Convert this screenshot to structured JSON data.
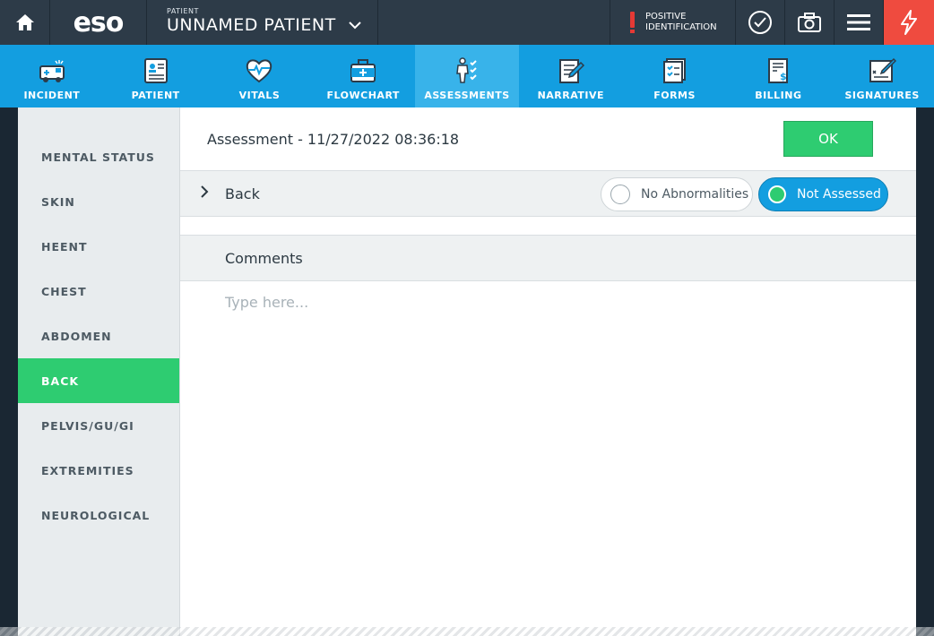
{
  "topbar": {
    "logo": "eso",
    "patient_label": "PATIENT",
    "patient_name": "UNNAMED PATIENT",
    "positive_id_line1": "POSITIVE",
    "positive_id_line2": "IDENTIFICATION"
  },
  "nav": {
    "items": [
      {
        "label": "INCIDENT",
        "icon": "ambulance-icon"
      },
      {
        "label": "PATIENT",
        "icon": "patient-card-icon"
      },
      {
        "label": "VITALS",
        "icon": "heart-pulse-icon"
      },
      {
        "label": "FLOWCHART",
        "icon": "medical-bag-icon"
      },
      {
        "label": "ASSESSMENTS",
        "icon": "body-check-icon"
      },
      {
        "label": "NARRATIVE",
        "icon": "notepad-icon"
      },
      {
        "label": "FORMS",
        "icon": "checklist-icon"
      },
      {
        "label": "BILLING",
        "icon": "bill-icon"
      },
      {
        "label": "SIGNATURES",
        "icon": "signature-icon"
      }
    ],
    "active": "ASSESSMENTS"
  },
  "sidebar": {
    "items": [
      {
        "label": "MENTAL STATUS"
      },
      {
        "label": "SKIN"
      },
      {
        "label": "HEENT"
      },
      {
        "label": "CHEST"
      },
      {
        "label": "ABDOMEN"
      },
      {
        "label": "BACK"
      },
      {
        "label": "PELVIS/GU/GI"
      },
      {
        "label": "EXTREMITIES"
      },
      {
        "label": "NEUROLOGICAL"
      }
    ],
    "active": "BACK"
  },
  "main": {
    "title": "Assessment - 11/27/2022 08:36:18",
    "ok_label": "OK",
    "section_label": "Back",
    "option_no_abnormalities": "No Abnormalities",
    "option_not_assessed": "Not Assessed",
    "selected_option": "Not Assessed",
    "comments_label": "Comments",
    "comments_placeholder": "Type here...",
    "comments_value": ""
  },
  "colors": {
    "topbar": "#2d3b48",
    "nav": "#139ee0",
    "active_green": "#2ecc71",
    "alert_red": "#ef4b3f"
  }
}
